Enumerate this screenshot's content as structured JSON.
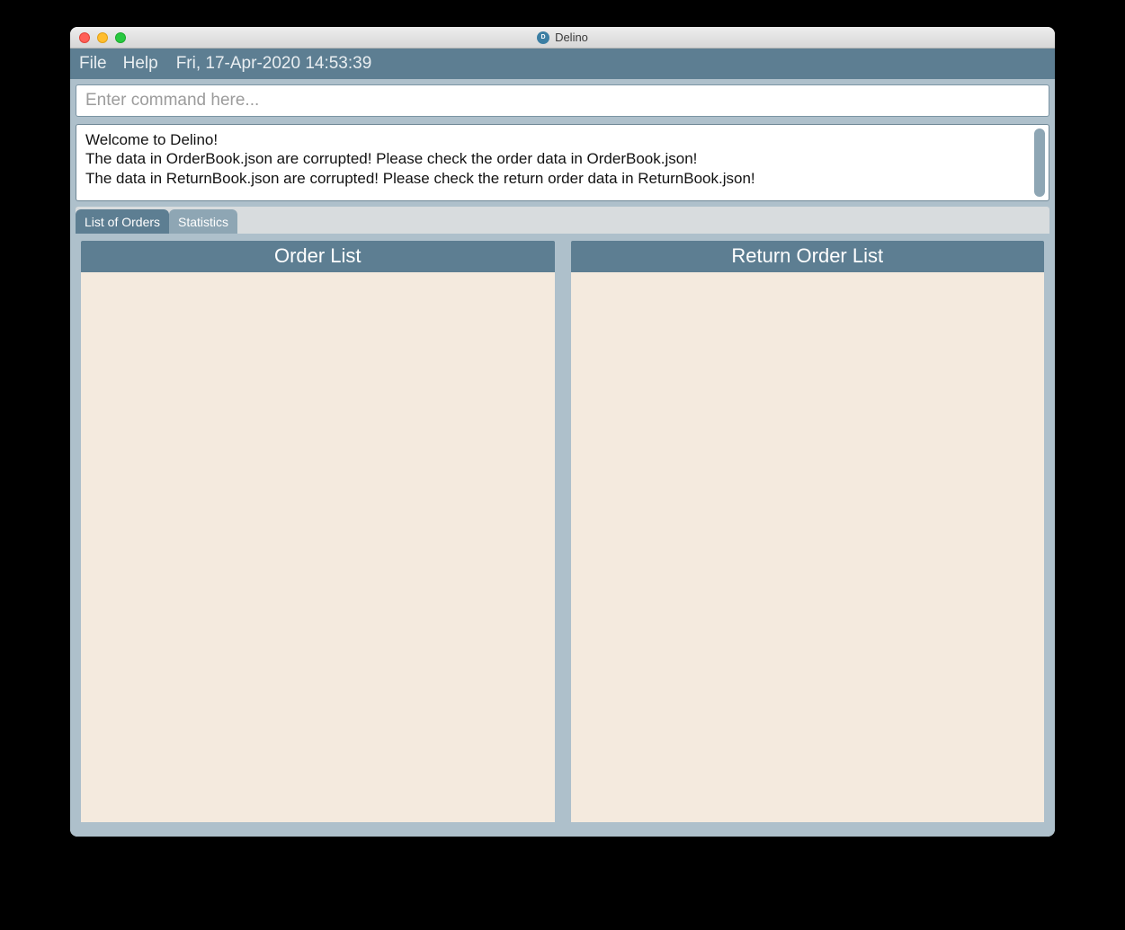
{
  "window": {
    "title": "Delino"
  },
  "menubar": {
    "file": "File",
    "help": "Help",
    "datetime": "Fri, 17-Apr-2020 14:53:39"
  },
  "command": {
    "placeholder": "Enter command here..."
  },
  "output": {
    "text": "Welcome to Delino!\nThe data in OrderBook.json are corrupted! Please check the order data in OrderBook.json!\nThe data in ReturnBook.json are corrupted! Please check the return order data in ReturnBook.json!"
  },
  "tabs": {
    "orders": "List of Orders",
    "statistics": "Statistics"
  },
  "panels": {
    "order_list_title": "Order List",
    "return_list_title": "Return Order List"
  }
}
